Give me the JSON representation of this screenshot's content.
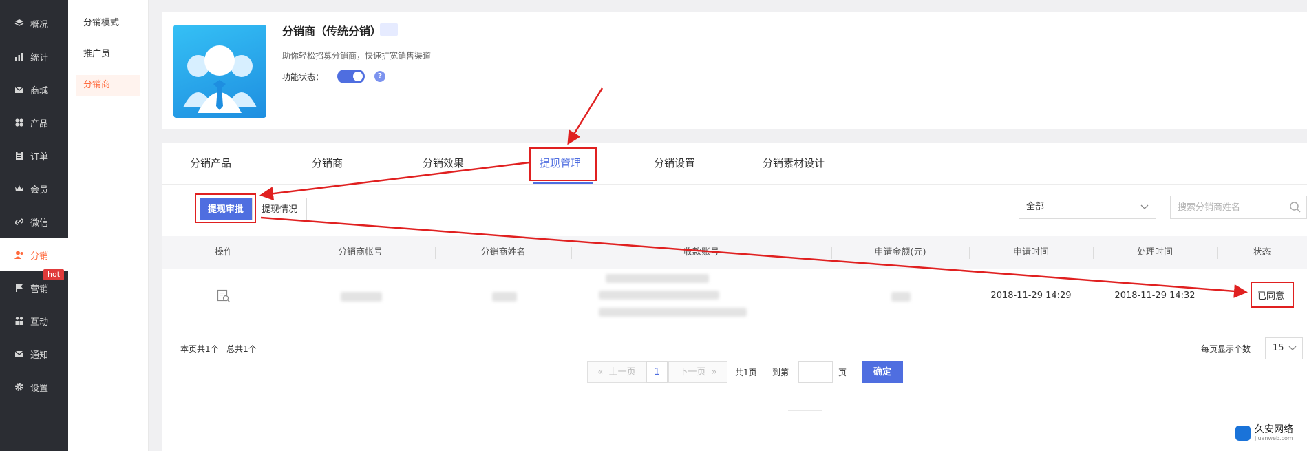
{
  "nav": {
    "items": [
      {
        "label": "概况",
        "icon": "layers-icon"
      },
      {
        "label": "统计",
        "icon": "chart-icon"
      },
      {
        "label": "商城",
        "icon": "mail-icon"
      },
      {
        "label": "产品",
        "icon": "grid-icon"
      },
      {
        "label": "订单",
        "icon": "clipboard-icon"
      },
      {
        "label": "会员",
        "icon": "crown-icon"
      },
      {
        "label": "微信",
        "icon": "link-icon"
      },
      {
        "label": "分销",
        "icon": "users-icon"
      },
      {
        "label": "营销",
        "icon": "flag-icon"
      },
      {
        "label": "互动",
        "icon": "interact-icon"
      },
      {
        "label": "通知",
        "icon": "envelope-icon"
      },
      {
        "label": "设置",
        "icon": "gear-icon"
      }
    ],
    "active_index": 7,
    "hot_badge": "hot",
    "accent_color": "#ff6a3d"
  },
  "subnav": {
    "items": [
      "分销模式",
      "推广员",
      "分销商"
    ],
    "active_index": 2
  },
  "header": {
    "title": "分销商（传统分销）",
    "description": "助你轻松招募分销商，快速扩宽销售渠道",
    "status_label": "功能状态：",
    "toggle_on": true,
    "help": "?"
  },
  "tabs": {
    "items": [
      "分销产品",
      "分销商",
      "分销效果",
      "提现管理",
      "分销设置",
      "分销素材设计"
    ],
    "active_index": 3
  },
  "subtabs": {
    "review": "提现审批",
    "status": "提现情况"
  },
  "filter": {
    "select_value": "全部",
    "search_placeholder": "搜索分销商姓名"
  },
  "table": {
    "headers": [
      "操作",
      "分销商帐号",
      "分销商姓名",
      "收款账号",
      "申请金额(元)",
      "申请时间",
      "处理时间",
      "状态"
    ],
    "rows": [
      {
        "apply_time": "2018-11-29 14:29",
        "process_time": "2018-11-29 14:32",
        "status": "已同意"
      }
    ]
  },
  "footer": {
    "page_summary": "本页共1个",
    "total_summary": "总共1个",
    "per_page_label": "每页显示个数",
    "per_page_value": "15",
    "prev": "上一页",
    "next": "下一页",
    "current_page": "1",
    "total_pages": "共1页",
    "goto_label": "到第",
    "page_unit": "页",
    "confirm": "确定"
  },
  "watermark": {
    "text": "久安网络",
    "sub": "jiuanweb.com"
  },
  "colors": {
    "primary": "#4f6ee0",
    "annotation_red": "#e02020",
    "sidebar_bg": "#2b2d33"
  }
}
